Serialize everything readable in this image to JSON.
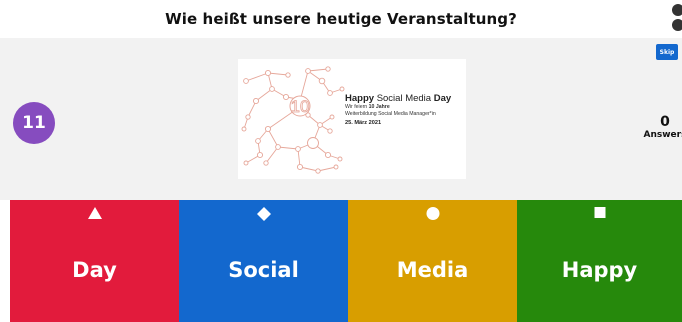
{
  "question": "Wie heißt unsere heutige Veranstaltung?",
  "timer": "11",
  "skip_label": "Skip",
  "answers_count": "0",
  "answers_label": "Answers",
  "media": {
    "title_happy": "Happy",
    "title_social_media": "Social Media",
    "title_day": "Day",
    "line1_prefix": "Wir feiern",
    "line1_bold": "10 Jahre",
    "line2": "Weiterbildung Social Media Manager*in",
    "date": "25. März 2021",
    "logo_number": "10"
  },
  "options": [
    {
      "label": "Day",
      "shape": "triangle-icon",
      "color": "#e21b3c"
    },
    {
      "label": "Social",
      "shape": "diamond-icon",
      "color": "#1368ce"
    },
    {
      "label": "Media",
      "shape": "circle-icon",
      "color": "#d89e00"
    },
    {
      "label": "Happy",
      "shape": "square-icon",
      "color": "#26890c"
    }
  ]
}
